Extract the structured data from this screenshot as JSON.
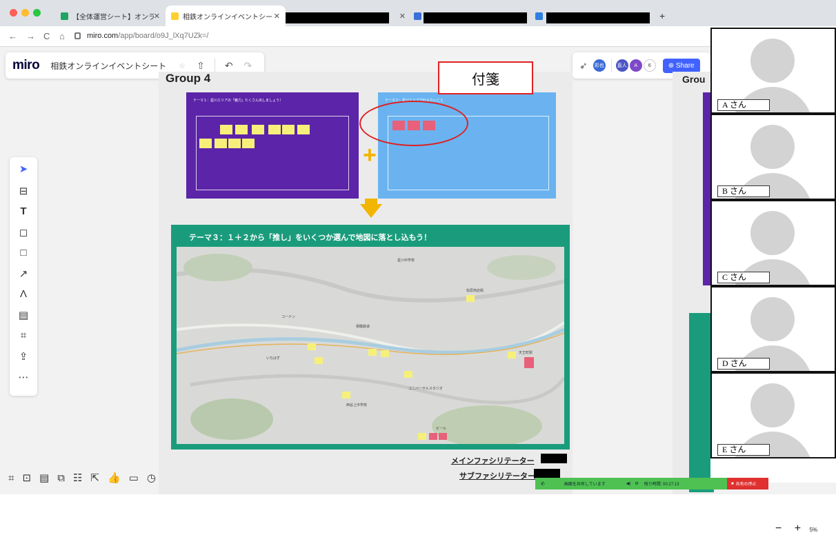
{
  "browser": {
    "tabs": [
      {
        "label": "【全体運営シート】オンライン",
        "active": false
      },
      {
        "label": "相鉄オンラインイベントシート",
        "active": true
      },
      {
        "label": "",
        "active": false
      },
      {
        "label": "",
        "active": false
      }
    ],
    "url_host": "miro.com",
    "url_path": "/app/board/o9J_lXq7UZk=/"
  },
  "miro": {
    "logo": "miro",
    "board_name": "相鉄オンラインイベントシート",
    "share_label": "Share",
    "collaborator_count": "6",
    "avatars": [
      "彩也",
      "直人",
      "A"
    ]
  },
  "board": {
    "group_title": "Group 4",
    "frame1_heading": "テーマ１：星川エリアの「魅力」たくさん出しましょう！",
    "frame2_heading": "テーマ２：星川エリアで叶えたいこと",
    "frame3_title": "テーマ３：１＋２から「推し」をいくつか選んで地図に落とし込もう！",
    "main_facilitator": "メインファシリテーター",
    "sub_facilitator": "サブファシリテーター",
    "group_title_right": "Grou",
    "map_labels": [
      "星川中学校",
      "松原商店街",
      "コーナン",
      "相模鉄道",
      "いちばず",
      "天王町駅",
      "ユニバーサルスタジオ",
      "ビール",
      "西谷上中学校"
    ]
  },
  "annotation": {
    "callout_label": "付箋"
  },
  "participants": [
    {
      "label": "A さん"
    },
    {
      "label": "B さん"
    },
    {
      "label": "C さん"
    },
    {
      "label": "D さん"
    },
    {
      "label": "E さん"
    }
  ],
  "screen_share": {
    "status": "画面を共有しています",
    "timer": "残り時間: 00:27:13",
    "stop_label": "共有の停止"
  },
  "zoom": {
    "level": "5%"
  },
  "colors": {
    "purple_frame": "#5c24a8",
    "blue_frame": "#6ab3f0",
    "green_frame": "#1a9c7c",
    "sticky_yellow": "#f6f07a",
    "sticky_pink": "#e8607a",
    "accent_red": "#e02020"
  }
}
